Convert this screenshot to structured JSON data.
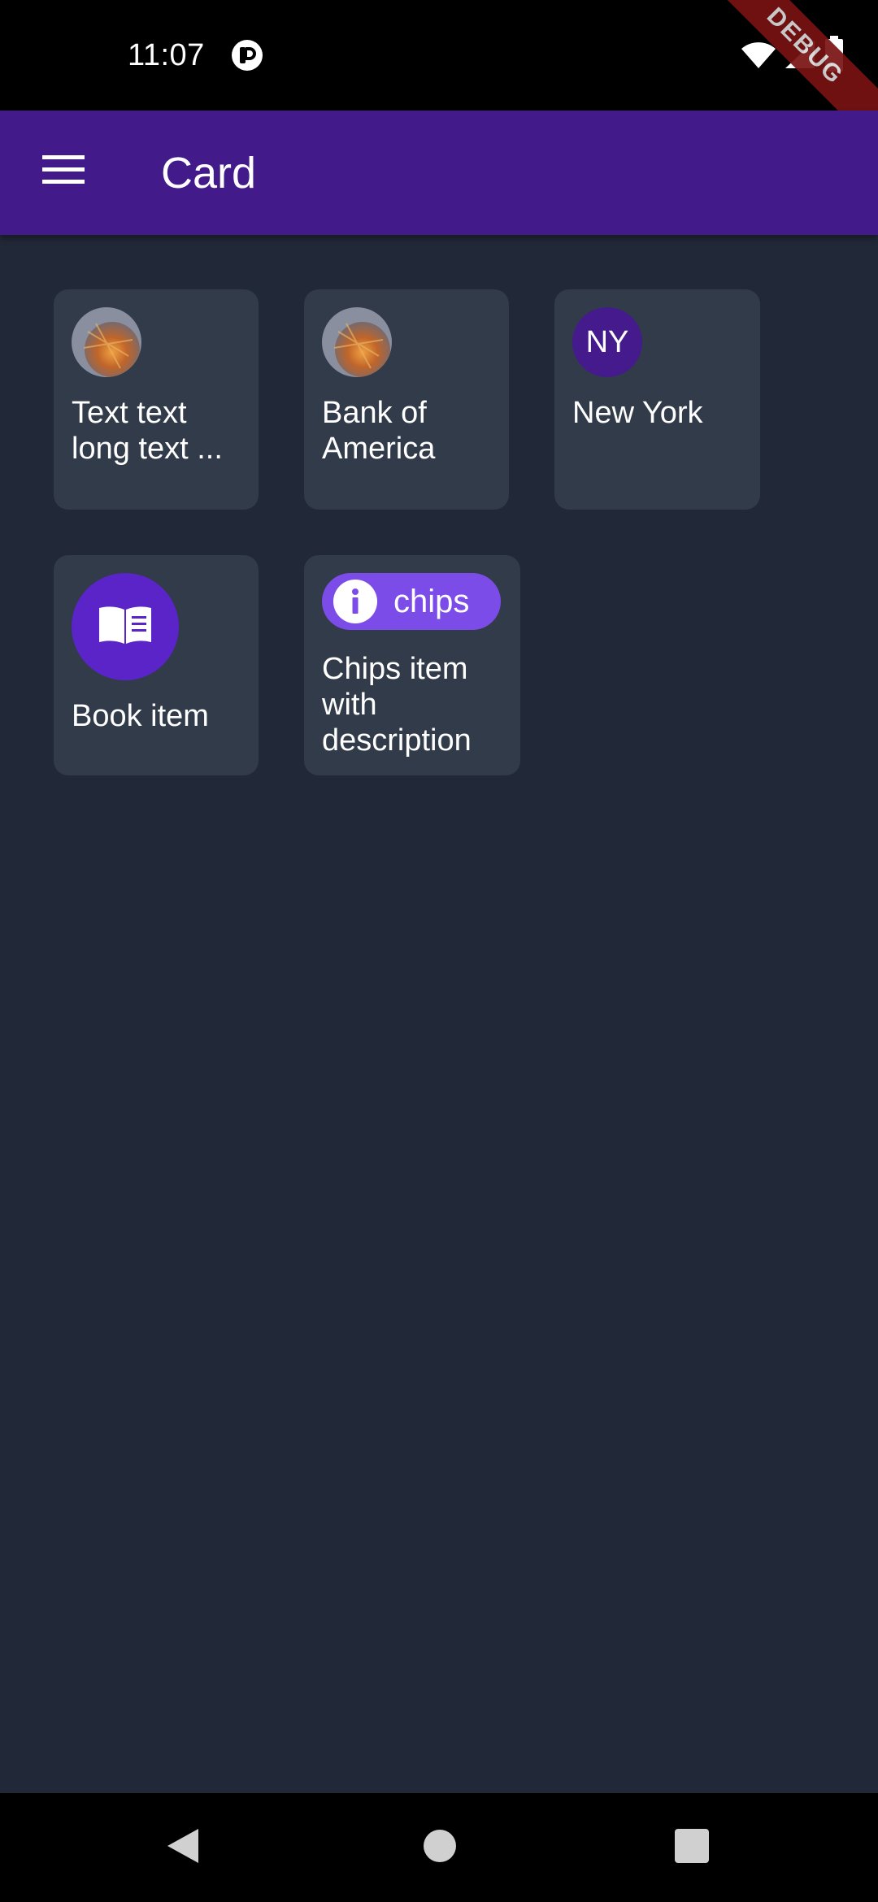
{
  "status_bar": {
    "time": "11:07",
    "icons": [
      "app-notification-icon",
      "wifi-icon",
      "cellular-signal-icon",
      "battery-icon"
    ],
    "debug_label": "DEBUG"
  },
  "app_bar": {
    "title": "Card",
    "menu_icon": "menu-icon",
    "background": "#431a8a"
  },
  "cards": [
    {
      "leading": "image-avatar",
      "title": "Text text long text ..."
    },
    {
      "leading": "image-avatar",
      "title": "Bank of America"
    },
    {
      "leading": "initials-avatar",
      "initials": "NY",
      "title": "New York"
    },
    {
      "leading": "book-icon",
      "title": "Book item"
    },
    {
      "leading": "chip",
      "chip_label": "chips",
      "chip_icon": "info-icon",
      "title": "Chips item with description"
    }
  ],
  "nav_bar": {
    "icons": [
      "back-icon",
      "home-icon",
      "recents-icon"
    ]
  },
  "colors": {
    "background": "#212838",
    "card": "#323b4a",
    "accent": "#5a24c8",
    "chip": "#7c4ce8"
  }
}
